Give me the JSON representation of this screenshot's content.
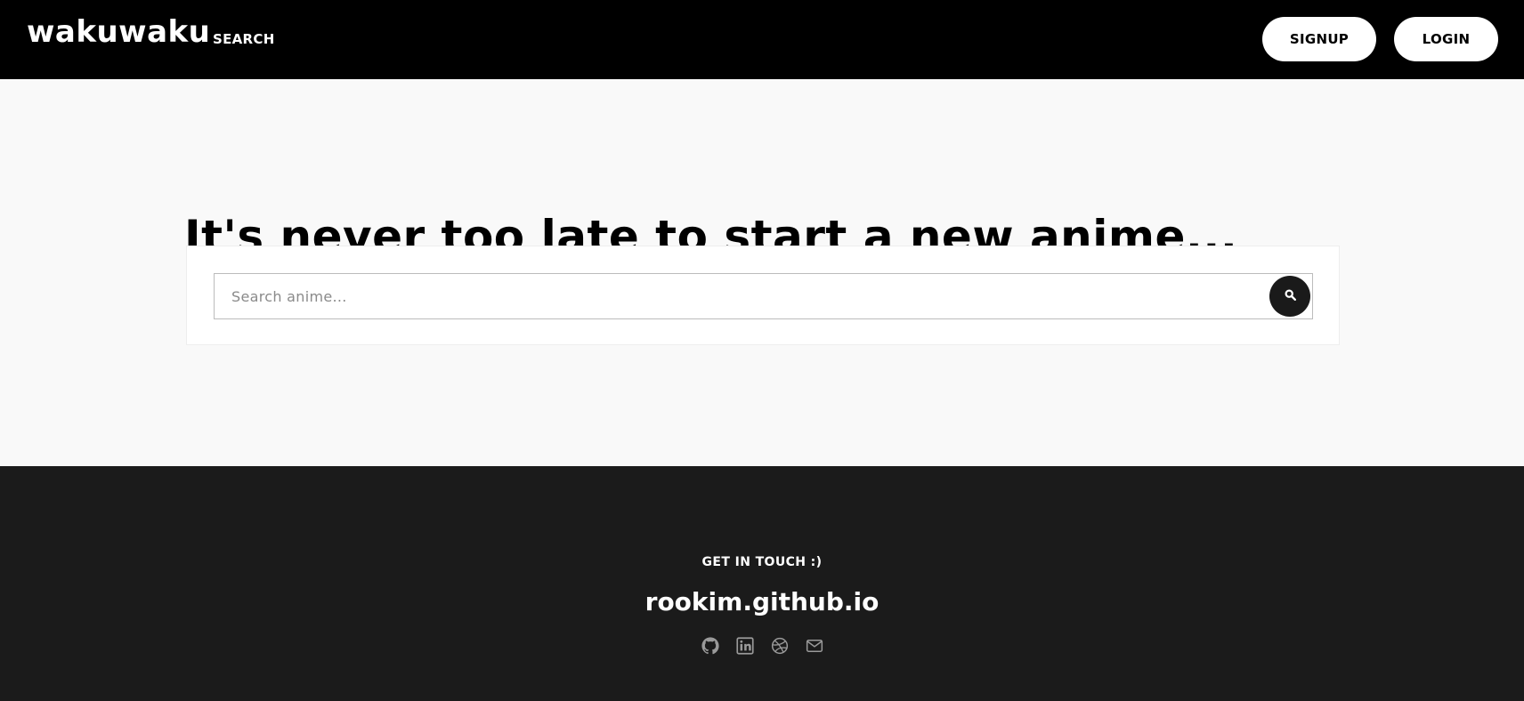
{
  "header": {
    "brand": "wakuwaku",
    "nav": [
      {
        "label": "SEARCH"
      }
    ],
    "signup_label": "SIGNUP",
    "login_label": "LOGIN"
  },
  "hero": {
    "title": "It's never too late to start a new anime...",
    "search": {
      "placeholder": "Search anime...",
      "value": "",
      "button_icon": "search-icon"
    }
  },
  "footer": {
    "eyebrow": "GET IN TOUCH :)",
    "site": "rookim.github.io",
    "icons": [
      "github-icon",
      "linkedin-icon",
      "dribbble-icon",
      "mail-icon"
    ]
  },
  "colors": {
    "nav_bg": "#000000",
    "page_bg": "#f9f9f9",
    "footer_bg": "#1b1b1b",
    "accent": "#1a1a1a",
    "icon_gray": "#9a9a9a"
  }
}
